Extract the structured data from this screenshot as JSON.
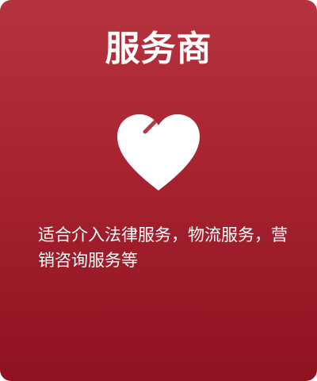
{
  "card": {
    "title": "服务商",
    "icon": "heart-icon",
    "description": "适合介入法律服务，物流服务，营销咨询服务等"
  },
  "colors": {
    "card_top": "#b5333e",
    "card_bottom": "#8f1220",
    "text": "#ffffff",
    "icon_fill": "#ffffff"
  }
}
